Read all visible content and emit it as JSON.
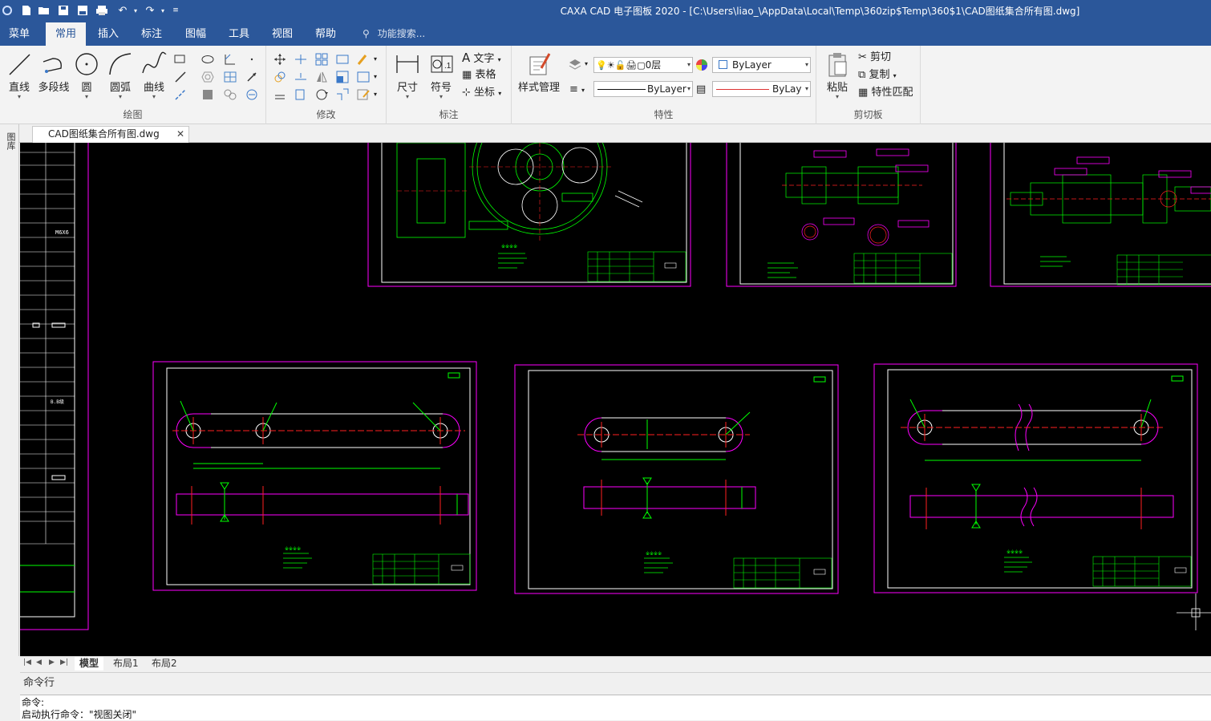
{
  "titlebar": {
    "title": "CAXA CAD 电子图板 2020 - [C:\\Users\\liao_\\AppData\\Local\\Temp\\360zip$Temp\\360$1\\CAD图纸集合所有图.dwg]"
  },
  "ribbon_tabs": [
    "菜单",
    "常用",
    "插入",
    "标注",
    "图幅",
    "工具",
    "视图",
    "帮助"
  ],
  "active_tab": "常用",
  "search": {
    "placeholder": "功能搜索..."
  },
  "groups": {
    "draw": {
      "label": "绘图",
      "buttons": [
        "直线",
        "多段线",
        "圆",
        "圆弧",
        "曲线"
      ]
    },
    "modify": {
      "label": "修改"
    },
    "annotate": {
      "label": "标注",
      "buttons": [
        "尺寸",
        "符号"
      ],
      "small": [
        "文字",
        "表格",
        "坐标"
      ]
    },
    "properties": {
      "label": "特性",
      "style_button": "样式管理",
      "layer": "0层",
      "color": "ByLayer",
      "linetype": "ByLayer",
      "lineweight": "ByLay"
    },
    "clipboard": {
      "label": "剪切板",
      "paste": "粘贴",
      "small": [
        "剪切",
        "复制",
        "特性匹配"
      ]
    }
  },
  "document_tab": {
    "name": "CAD图纸集合所有图.dwg"
  },
  "side_panel": {
    "label": "图库"
  },
  "layout_tabs": [
    "模型",
    "布局1",
    "布局2"
  ],
  "active_layout": "模型",
  "command": {
    "header": "命令行",
    "lines": [
      "命令:",
      "启动执行命令：\"视图关闭\""
    ]
  },
  "canvas_labels": [
    "M6X6",
    "B.B级"
  ],
  "colors": {
    "accent": "#2b579a",
    "canvas_bg": "#000000",
    "frame_magenta": "#ff00ff",
    "line_green": "#00ff00",
    "line_white": "#ffffff",
    "line_red": "#ff2020"
  },
  "icons": [
    "new-icon",
    "open-icon",
    "save-icon",
    "save-as-icon",
    "print-icon",
    "undo-icon",
    "redo-icon"
  ]
}
